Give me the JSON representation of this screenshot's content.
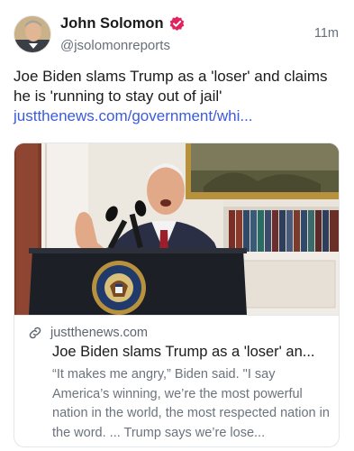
{
  "post": {
    "author_name": "John Solomon",
    "handle": "@jsolomonreports",
    "time": "11m",
    "text": "Joe Biden slams Trump as a 'loser' and claims he is 'running to stay out of jail'",
    "link_text": "justthenews.com/government/whi..."
  },
  "card": {
    "domain": "justthenews.com",
    "title": "Joe Biden slams Trump as a 'loser' an...",
    "description": "“It makes me angry,” Biden said. \"I say America’s winning, we’re the most powerful nation in the world, the most respected nation in the word. ... Trump says we’re lose..."
  },
  "colors": {
    "verified_badge": "#e0245e",
    "link": "#3b5bdb"
  },
  "icons": {
    "verified": "verified-badge-icon",
    "link": "link-icon"
  }
}
